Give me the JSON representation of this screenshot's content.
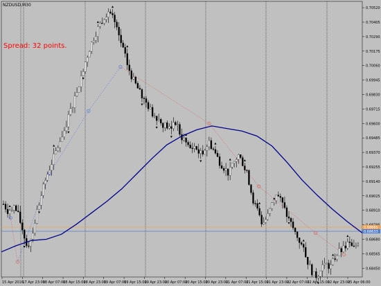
{
  "chart_title": "NZDUSD,M30",
  "spread_text": "Spread: 32 points.",
  "chart_data": {
    "type": "candlestick",
    "symbol": "NZDUSD",
    "timeframe": "M30",
    "y_ticks": [
      "0.70520",
      "0.70405",
      "0.70290",
      "0.70175",
      "0.70060",
      "0.69945",
      "0.69830",
      "0.69715",
      "0.69600",
      "0.69485",
      "0.69370",
      "0.69255",
      "0.69140",
      "0.69025",
      "0.68910",
      "0.68795",
      "0.68680",
      "0.68565",
      "0.68450"
    ],
    "ylim": [
      0.6838,
      0.7057
    ],
    "x_ticks": [
      "15 Apr 2016",
      "17 Apr 23:00",
      "18 Apr 07:00",
      "18 Apr 15:00",
      "18 Apr 23:00",
      "19 Apr 07:00",
      "19 Apr 15:00",
      "19 Apr 23:00",
      "20 Apr 07:00",
      "20 Apr 15:00",
      "20 Apr 23:00",
      "21 Apr 07:00",
      "21 Apr 15:00",
      "21 Apr 23:00",
      "22 Apr 07:00",
      "22 Apr 15:00",
      "22 Apr 23:00",
      "25 Apr 06:00"
    ],
    "price_labels": [
      {
        "value": "0.68665",
        "color": "#f0a050"
      },
      {
        "value": "0.68633",
        "color": "#4f7fd0"
      }
    ],
    "moving_average": {
      "color": "#00008b",
      "values": [
        0.6858,
        0.6863,
        0.6867,
        0.6868,
        0.6872,
        0.688,
        0.6889,
        0.6898,
        0.6908,
        0.692,
        0.6932,
        0.6943,
        0.695,
        0.6955,
        0.6958,
        0.6956,
        0.6954,
        0.695,
        0.6942,
        0.6929,
        0.6915,
        0.6903,
        0.6892,
        0.6882,
        0.6873
      ]
    },
    "close_path": [
      0.6896,
      0.689,
      0.6895,
      0.6888,
      0.6875,
      0.6862,
      0.6872,
      0.689,
      0.6905,
      0.6918,
      0.6928,
      0.6938,
      0.6948,
      0.6958,
      0.697,
      0.6982,
      0.6995,
      0.7008,
      0.702,
      0.703,
      0.7038,
      0.7045,
      0.705,
      0.7042,
      0.703,
      0.7018,
      0.7005,
      0.6995,
      0.6988,
      0.698,
      0.6975,
      0.6968,
      0.6965,
      0.696,
      0.6958,
      0.6955,
      0.6962,
      0.695,
      0.6945,
      0.694,
      0.6942,
      0.6935,
      0.694,
      0.6945,
      0.6938,
      0.693,
      0.6925,
      0.692,
      0.6928,
      0.6935,
      0.6928,
      0.6918,
      0.69,
      0.689,
      0.688,
      0.6885,
      0.6895,
      0.6905,
      0.6898,
      0.6888,
      0.688,
      0.6872,
      0.6865,
      0.6855,
      0.6845,
      0.6838,
      0.6842,
      0.685,
      0.6845,
      0.6852,
      0.6858,
      0.686,
      0.6865,
      0.686,
      0.6866
    ],
    "circle_markers": [
      {
        "i": 2,
        "v": 0.6885
      },
      {
        "i": 4,
        "v": 0.685
      },
      {
        "i": 13,
        "v": 0.692
      },
      {
        "i": 24,
        "v": 0.697
      },
      {
        "i": 33,
        "v": 0.7005
      },
      {
        "i": 58,
        "v": 0.696
      },
      {
        "i": 72,
        "v": 0.691
      },
      {
        "i": 88,
        "v": 0.6873
      },
      {
        "i": 96,
        "v": 0.6856
      }
    ]
  }
}
